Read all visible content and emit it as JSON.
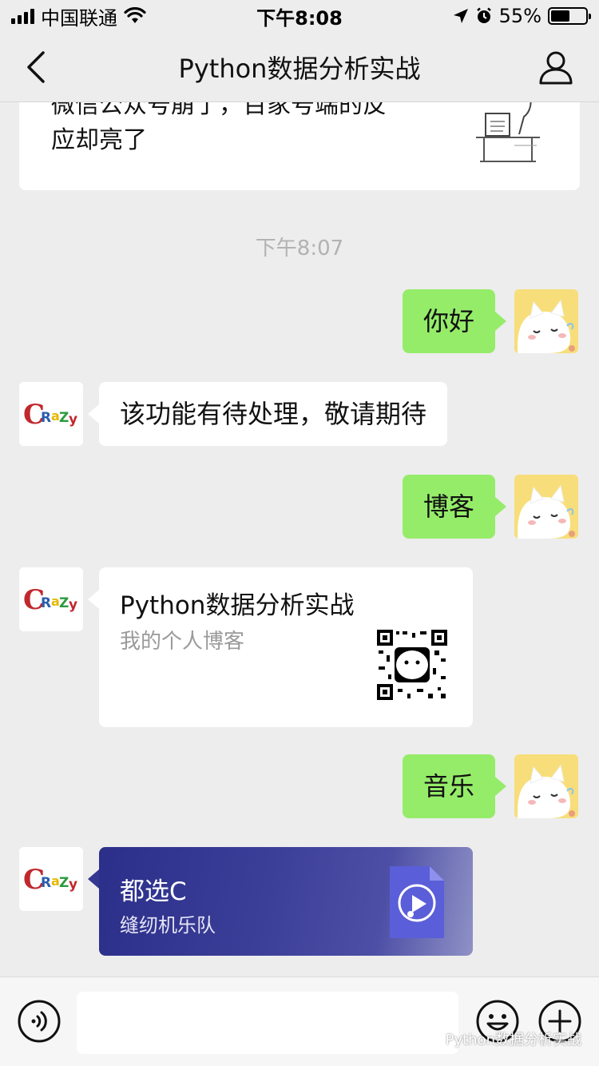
{
  "status_bar": {
    "carrier": "中国联通",
    "time": "下午8:08",
    "battery": "55%",
    "battery_level": 0.55,
    "icons": [
      "signal-icon",
      "wifi-icon",
      "location-icon",
      "alarm-icon",
      "battery-icon"
    ]
  },
  "nav": {
    "title": "Python数据分析实战",
    "icons": [
      "back-icon",
      "profile-icon"
    ]
  },
  "chat": {
    "previous_card_text_hidden": "微信公众号崩了，百家号端的反",
    "previous_card_text": "应却亮了",
    "timestamp": "下午8:07",
    "messages": [
      {
        "side": "right",
        "text": "你好"
      },
      {
        "side": "left",
        "text": "该功能有待处理，敬请期待"
      },
      {
        "side": "right",
        "text": "博客"
      },
      {
        "side": "left",
        "type": "link-card",
        "title": "Python数据分析实战",
        "subtitle": "我的个人博客"
      },
      {
        "side": "right",
        "text": "音乐"
      },
      {
        "side": "left",
        "type": "music-card",
        "title": "都选C",
        "artist": "缝纫机乐队"
      }
    ]
  },
  "input_bar": {
    "placeholder": "",
    "icons": [
      "voice-icon",
      "emoji-icon",
      "plus-icon"
    ]
  },
  "watermark": "Python数据分析实战",
  "colors": {
    "background": "#ededed",
    "sent_bubble": "#95ec69",
    "received_bubble": "#ffffff",
    "music_card": "#3c3f98"
  }
}
